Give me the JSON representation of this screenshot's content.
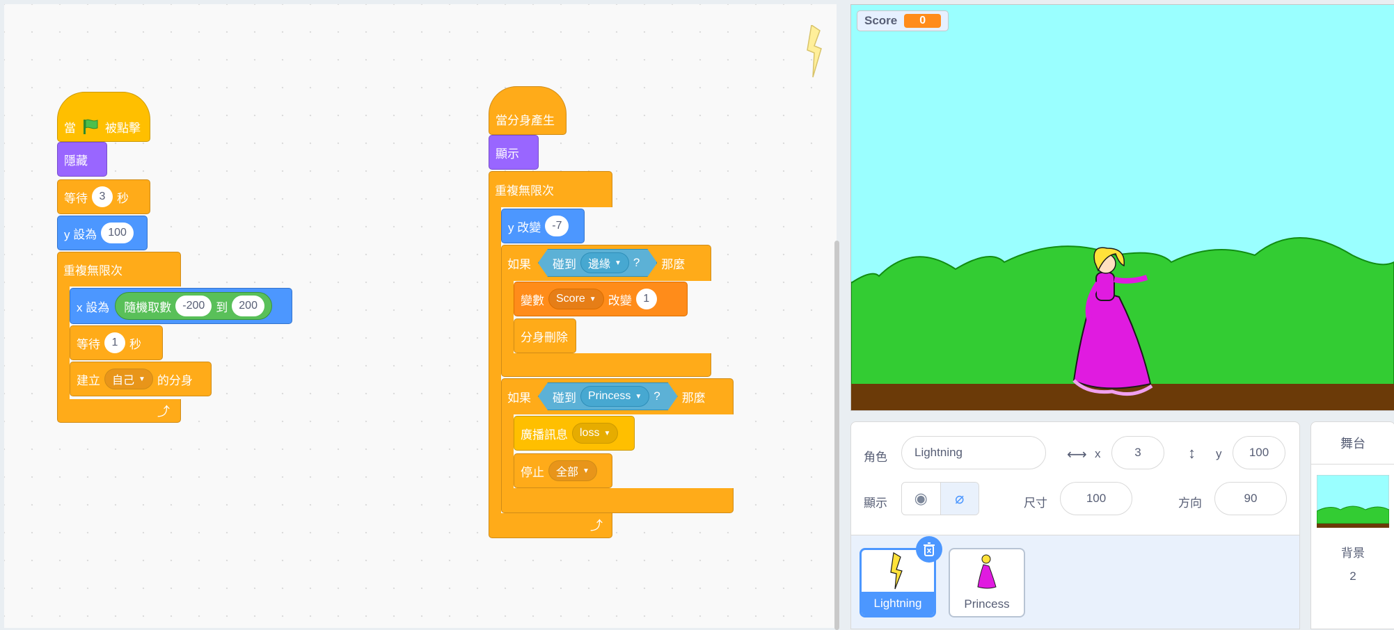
{
  "script1": {
    "when_flag": "當",
    "when_flag_suffix": "被點擊",
    "hide": "隱藏",
    "wait1_label": "等待",
    "wait1_value": "3",
    "wait1_unit": "秒",
    "sety_label": "y 設為",
    "sety_value": "100",
    "forever": "重複無限次",
    "setx_label": "x 設為",
    "random_label": "隨機取數",
    "random_from": "-200",
    "random_to_label": "到",
    "random_to": "200",
    "wait2_label": "等待",
    "wait2_value": "1",
    "wait2_unit": "秒",
    "clone_label": "建立",
    "clone_target": "自己",
    "clone_suffix": "的分身"
  },
  "script2": {
    "clone_start": "當分身產生",
    "show": "顯示",
    "forever": "重複無限次",
    "change_y_label": "y 改變",
    "change_y_value": "-7",
    "if1_label": "如果",
    "touching1_label": "碰到",
    "touching1_target": "邊緣",
    "touching_q": "?",
    "if1_then": "那麼",
    "var_label": "變數",
    "var_name": "Score",
    "var_change_label": "改變",
    "var_change_value": "1",
    "delete_clone": "分身刪除",
    "if2_label": "如果",
    "touching2_label": "碰到",
    "touching2_target": "Princess",
    "if2_then": "那麼",
    "broadcast_label": "廣播訊息",
    "broadcast_msg": "loss",
    "stop_label": "停止",
    "stop_option": "全部"
  },
  "stage": {
    "monitor_label": "Score",
    "monitor_value": "0",
    "sky_color": "#9affff",
    "bush_color": "#33cc33",
    "ground_color": "#6b3a08"
  },
  "sprite_info": {
    "sprite_label": "角色",
    "sprite_name": "Lightning",
    "x_label": "x",
    "x_value": "3",
    "y_label": "y",
    "y_value": "100",
    "show_label": "顯示",
    "size_label": "尺寸",
    "size_value": "100",
    "direction_label": "方向",
    "direction_value": "90"
  },
  "sprites": [
    {
      "name": "Lightning",
      "selected": true
    },
    {
      "name": "Princess",
      "selected": false
    }
  ],
  "stage_pane": {
    "title": "舞台",
    "backdrops_label": "背景",
    "backdrops_count": "2"
  }
}
